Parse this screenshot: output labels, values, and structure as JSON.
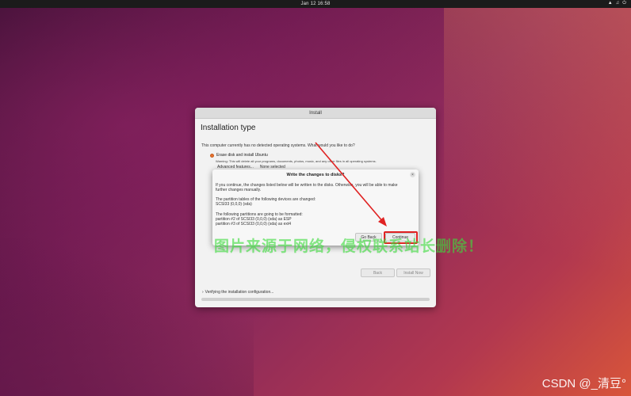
{
  "topbar": {
    "clock": "Jan 12  16:58",
    "icons": [
      "network-icon",
      "volume-icon",
      "power-icon"
    ]
  },
  "window": {
    "title": "Install",
    "page_title": "Installation type",
    "intro": "This computer currently has no detected operating systems. What would you like to do?",
    "option_label": "Erase disk and install Ubuntu",
    "warning": "Warning: This will delete all your programs, documents, photos, music, and any other files in all operating systems.",
    "advanced_label": "Advanced features...",
    "advanced_value": "None selected",
    "back_label": "Back",
    "install_label": "Install Now",
    "status": "Verifying the installation configuration...",
    "progress": 0
  },
  "dialog": {
    "title": "Write the changes to disks?",
    "text1": "If you continue, the changes listed below will be written to the disks. Otherwise, you will be able to make",
    "text2": "further changes manually.",
    "text3": "The partition tables of the following devices are changed:",
    "text4": "SCSI33 (0,0,0) (sda)",
    "text5": "The following partitions are going to be formatted:",
    "text6": "partition #2 of SCSI33 (0,0,0) (sda) as ESP",
    "text7": "partition #3 of SCSI33 (0,0,0) (sda) as ext4",
    "go_back_label": "Go Back",
    "continue_label": "Continue"
  },
  "overlay": {
    "watermark": "图片来源于网络，侵权联系站长删除！",
    "credit": "CSDN @_清豆°"
  },
  "colors": {
    "accent": "#e9712e",
    "highlight": "#e02222"
  }
}
